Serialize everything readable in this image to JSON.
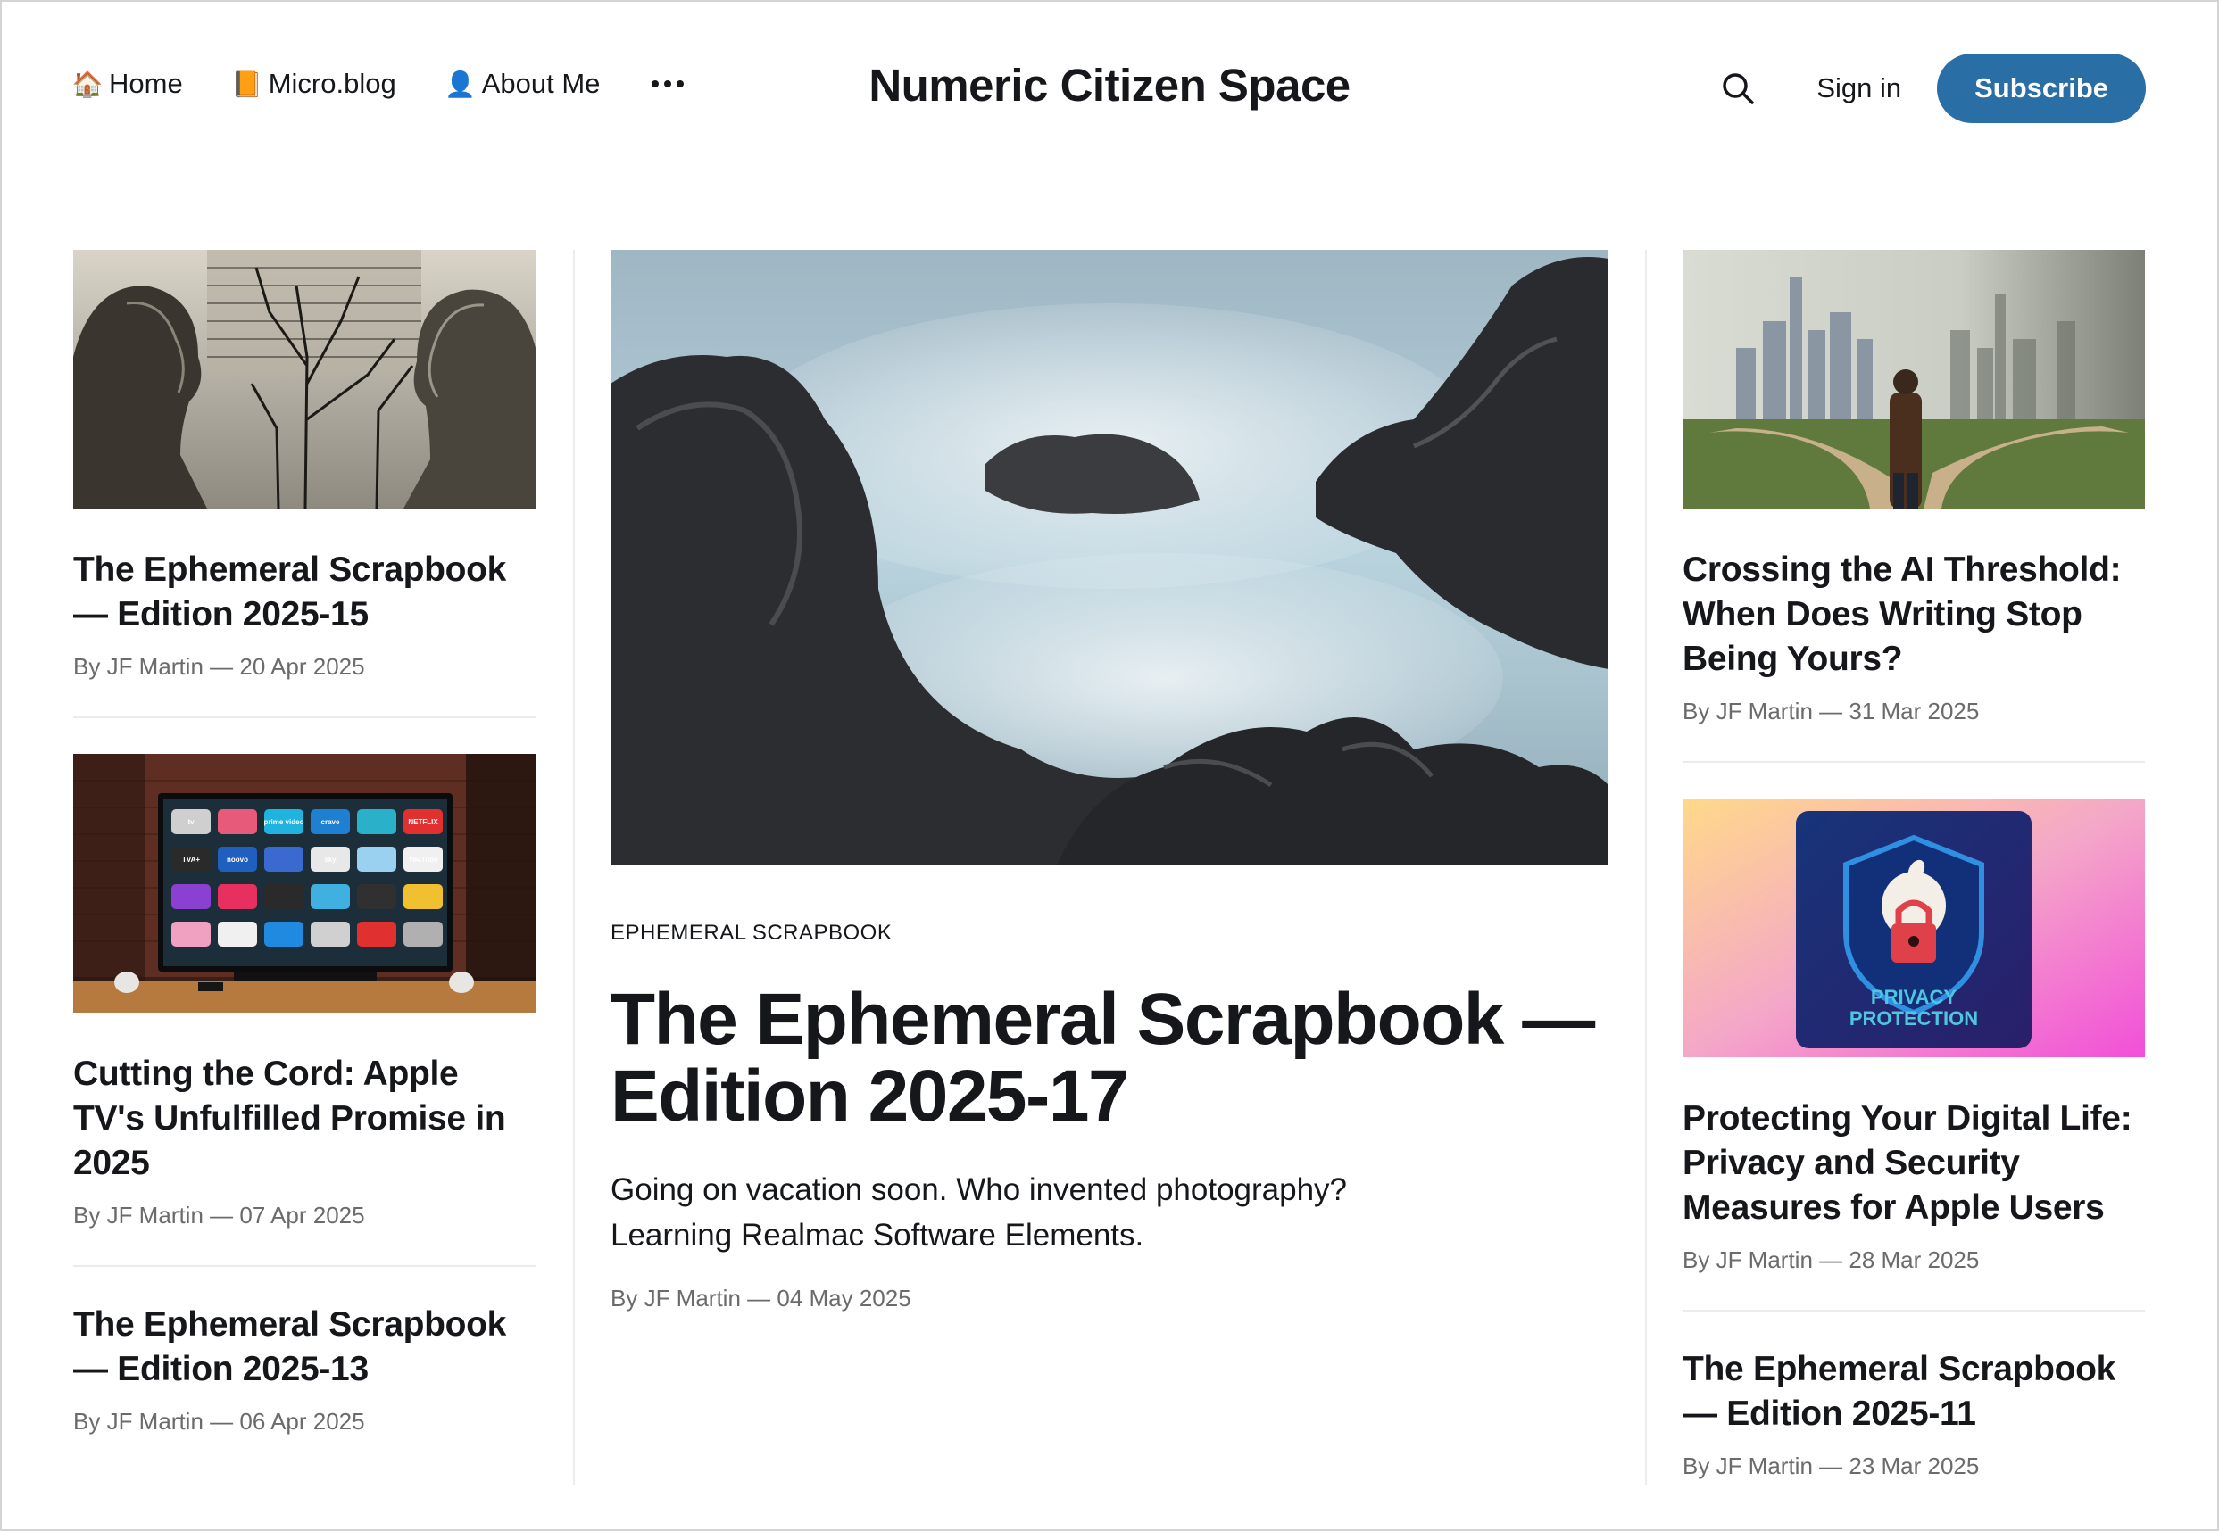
{
  "header": {
    "nav": [
      {
        "emoji": "🏠",
        "label": "Home"
      },
      {
        "emoji": "📙",
        "label": "Micro.blog"
      },
      {
        "emoji": "👤",
        "label": "About Me"
      }
    ],
    "site_title": "Numeric Citizen Space",
    "sign_in": "Sign in",
    "subscribe": "Subscribe",
    "accent_color": "#2a6ea6"
  },
  "left": [
    {
      "title": "The Ephemeral Scrapbook — Edition 2025-15",
      "meta": "By JF Martin — 20 Apr 2025"
    },
    {
      "title": "Cutting the Cord: Apple TV's Unfulfilled Promise in 2025",
      "meta": "By JF Martin — 07 Apr 2025"
    },
    {
      "title": "The Ephemeral Scrapbook — Edition 2025-13",
      "meta": "By JF Martin — 06 Apr 2025"
    }
  ],
  "featured": {
    "kicker": "EPHEMERAL SCRAPBOOK",
    "title": "The Ephemeral Scrapbook — Edition 2025-17",
    "excerpt": "Going on vacation soon. Who invented photography? Learning Realmac Software Elements.",
    "meta": "By JF Martin — 04 May 2025"
  },
  "right": [
    {
      "title": "Crossing the AI Threshold: When Does Writing Stop Being Yours?",
      "meta": "By JF Martin — 31 Mar 2025"
    },
    {
      "title": "Protecting Your Digital Life: Privacy and Security Measures for Apple Users",
      "meta": "By JF Martin — 28 Mar 2025",
      "image_text_1": "PRIVACY",
      "image_text_2": "PROTECTION"
    },
    {
      "title": "The Ephemeral Scrapbook — Edition 2025-11",
      "meta": "By JF Martin — 23 Mar 2025"
    }
  ],
  "tv_apps": [
    "tv",
    "",
    "prime video",
    "crave",
    "",
    "NETFLIX",
    "TVA+",
    "noovo",
    "",
    "sky",
    "",
    "YouTube",
    "",
    "",
    "",
    "",
    "",
    "",
    "",
    "",
    "",
    "",
    "",
    ""
  ]
}
